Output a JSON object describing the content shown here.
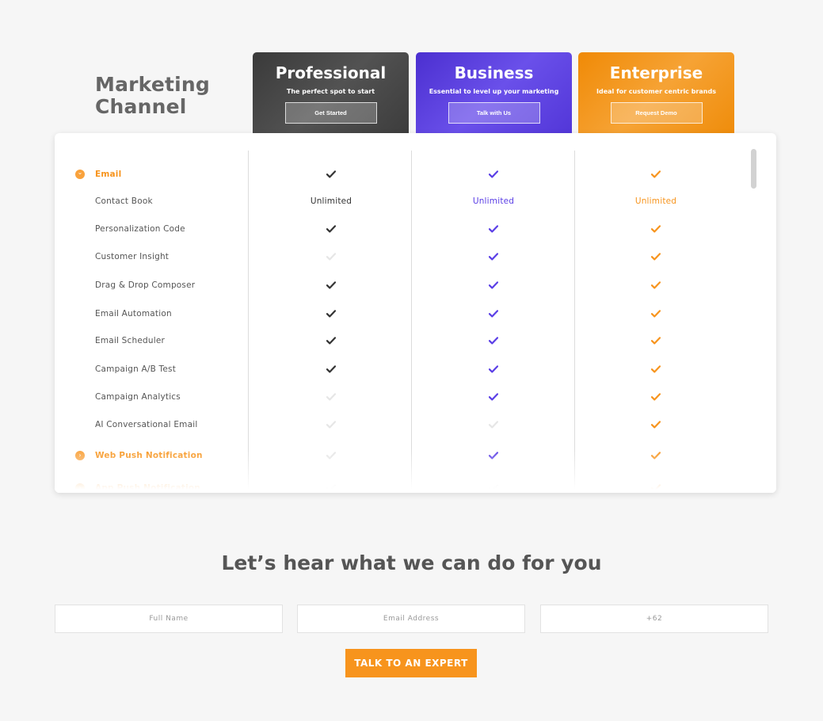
{
  "section_title": [
    "Marketing",
    "Channel"
  ],
  "colors": {
    "professional": "#3f3f3f",
    "business": "#5a3ee6",
    "enterprise": "#f7941d",
    "unavailable": "#e6e6e6"
  },
  "plans": [
    {
      "name": "Professional",
      "tagline": "The perfect spot to start",
      "button": "Get Started"
    },
    {
      "name": "Business",
      "tagline": "Essential to level up your marketing",
      "button": "Talk with Us"
    },
    {
      "name": "Enterprise",
      "tagline": "Ideal for customer centric brands",
      "button": "Request Demo"
    }
  ],
  "features": [
    {
      "label": "Email",
      "category": true,
      "icon": "chevron-down-icon",
      "cells": [
        "check",
        "check",
        "check"
      ]
    },
    {
      "label": "Contact Book",
      "cells": [
        "Unlimited",
        "Unlimited",
        "Unlimited"
      ]
    },
    {
      "label": "Personalization Code",
      "cells": [
        "check",
        "check",
        "check"
      ]
    },
    {
      "label": "Customer Insight",
      "cells": [
        "none",
        "check",
        "check"
      ]
    },
    {
      "label": "Drag & Drop Composer",
      "cells": [
        "check",
        "check",
        "check"
      ]
    },
    {
      "label": "Email Automation",
      "cells": [
        "check",
        "check",
        "check"
      ]
    },
    {
      "label": "Email Scheduler",
      "cells": [
        "check",
        "check",
        "check"
      ]
    },
    {
      "label": "Campaign A/B Test",
      "cells": [
        "check",
        "check",
        "check"
      ]
    },
    {
      "label": "Campaign Analytics",
      "cells": [
        "none",
        "check",
        "check"
      ]
    },
    {
      "label": "AI Conversational Email",
      "cells": [
        "none",
        "none",
        "check"
      ]
    },
    {
      "label": "Web Push Notification",
      "category": true,
      "icon": "chevron-right-icon",
      "cells": [
        "none",
        "check",
        "check"
      ]
    },
    {
      "label": "App Push Notification",
      "category": true,
      "icon": "chevron-right-icon",
      "cells": [
        "none",
        "none",
        "check"
      ]
    }
  ],
  "cta": {
    "title": "Let’s hear what we can do for you",
    "full_name_placeholder": "Full Name",
    "email_placeholder": "Email Address",
    "phone_placeholder": "+62",
    "button": "TALK TO AN EXPERT"
  }
}
